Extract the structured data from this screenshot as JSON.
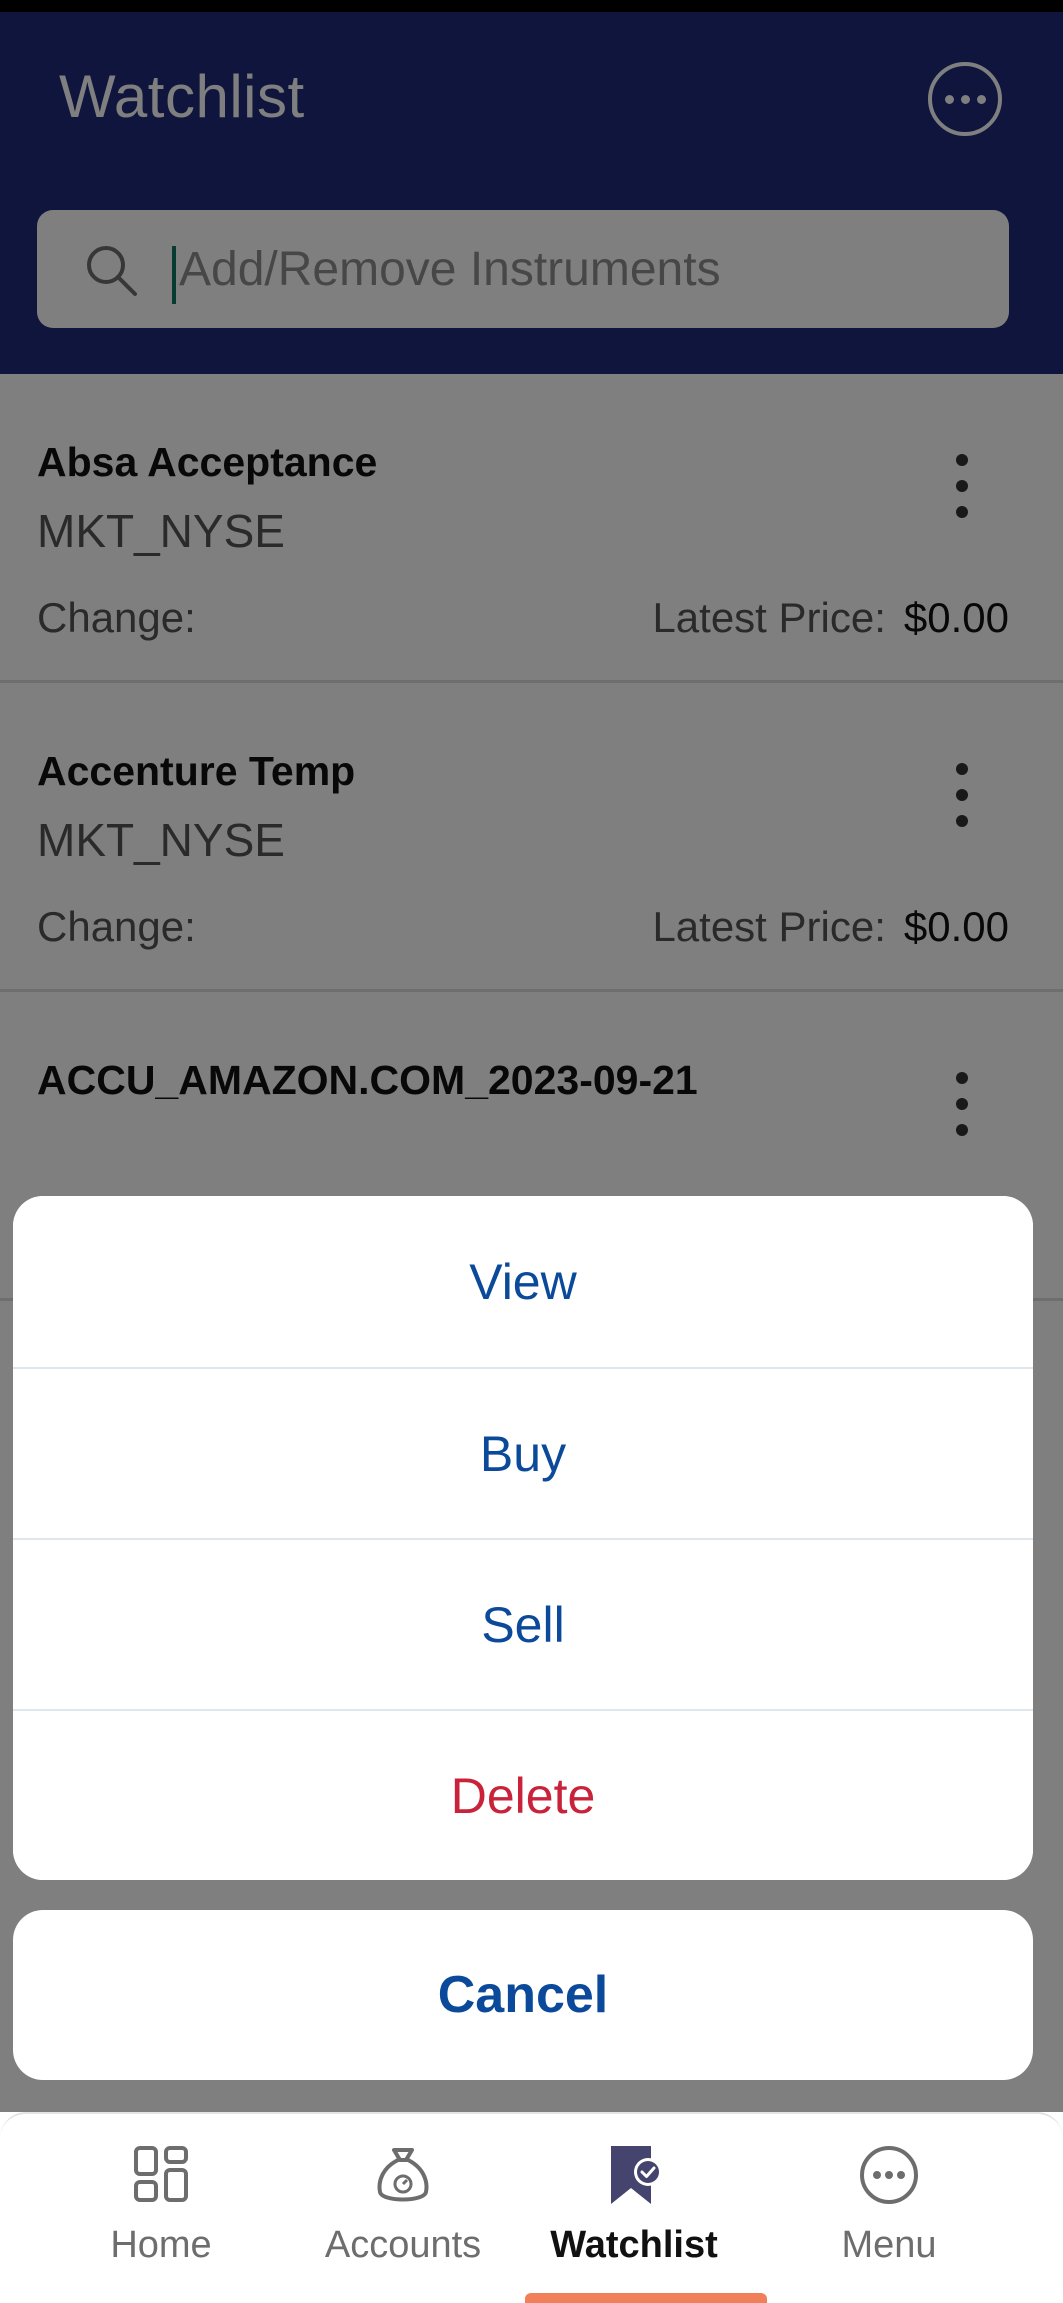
{
  "header": {
    "title": "Watchlist",
    "more_icon": "more-horizontal-circle-icon"
  },
  "search": {
    "placeholder": "Add/Remove Instruments",
    "icon": "search-icon"
  },
  "watchlist": {
    "items": [
      {
        "name": "Absa Acceptance",
        "market": "MKT_NYSE",
        "change_label": "Change:",
        "price_label": "Latest Price:",
        "price_value": "$0.00"
      },
      {
        "name": "Accenture Temp",
        "market": "MKT_NYSE",
        "change_label": "Change:",
        "price_label": "Latest Price:",
        "price_value": "$0.00"
      },
      {
        "name": "ACCU_AMAZON.COM_2023-09-21",
        "market": "",
        "change_label": "",
        "price_label": "",
        "price_value": ""
      }
    ]
  },
  "action_sheet": {
    "view": "View",
    "buy": "Buy",
    "sell": "Sell",
    "delete": "Delete",
    "cancel": "Cancel"
  },
  "nav": {
    "home": "Home",
    "accounts": "Accounts",
    "watchlist": "Watchlist",
    "menu": "Menu",
    "active": "watchlist"
  },
  "colors": {
    "header_bg": "#1f2a78",
    "action_text": "#0b4a9a",
    "delete_text": "#c8233a",
    "active_indicator": "#f07f5a"
  }
}
